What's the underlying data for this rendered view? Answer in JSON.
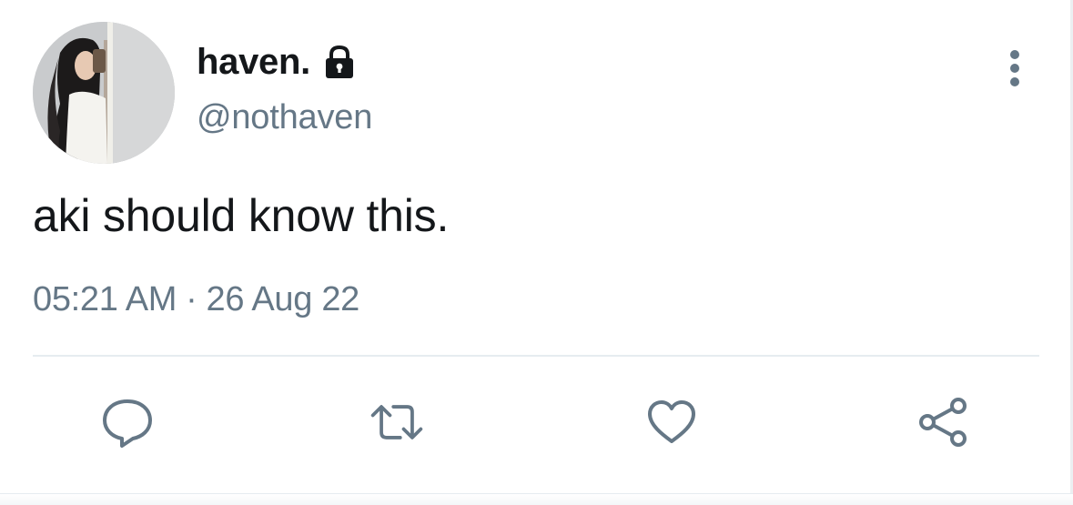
{
  "tweet": {
    "display_name": "haven.",
    "handle": "@nothaven",
    "text": "aki should know this.",
    "time": "05:21 AM",
    "separator": "·",
    "date": "26 Aug 22"
  },
  "icons": {
    "avatar": "profile-photo",
    "protected": "lock-icon",
    "more": "more-vertical-icon",
    "reply": "reply-icon",
    "retweet": "retweet-icon",
    "like": "heart-icon",
    "share": "share-icon"
  },
  "colors": {
    "text_primary": "#14171a",
    "text_secondary": "#657786",
    "divider": "#e6ecf0"
  }
}
